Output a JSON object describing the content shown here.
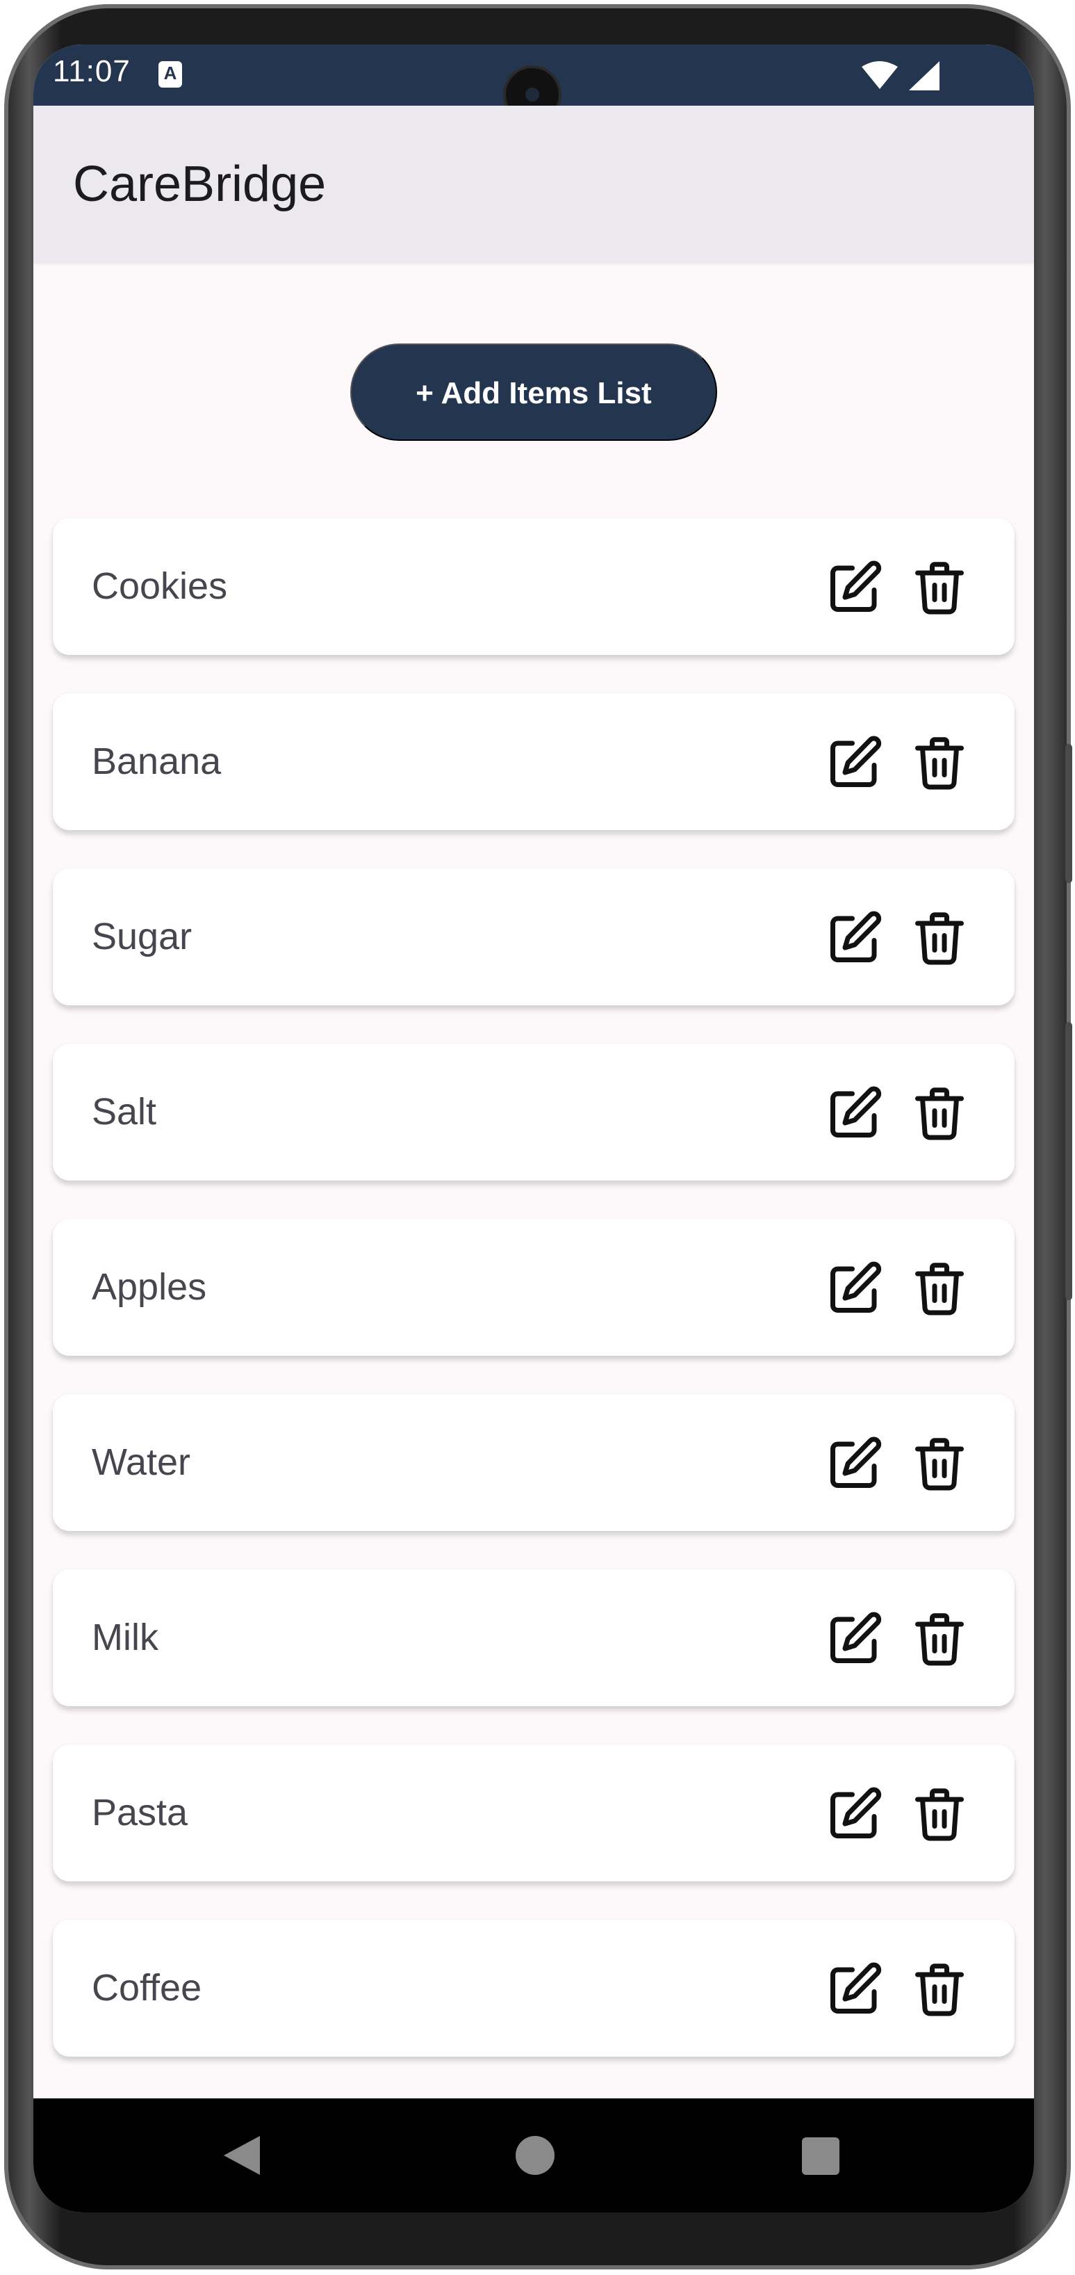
{
  "status_bar": {
    "time": "11:07",
    "notification_badge": "A",
    "icons": [
      "wifi-icon",
      "cellular-signal-icon"
    ]
  },
  "app_bar": {
    "title": "CareBridge"
  },
  "add_button": {
    "label": "+ Add Items List"
  },
  "items": [
    {
      "label": "Cookies"
    },
    {
      "label": "Banana"
    },
    {
      "label": "Sugar"
    },
    {
      "label": "Salt"
    },
    {
      "label": "Apples"
    },
    {
      "label": "Water"
    },
    {
      "label": "Milk"
    },
    {
      "label": "Pasta"
    },
    {
      "label": "Coffee"
    }
  ],
  "item_actions": {
    "edit_icon": "edit-icon",
    "delete_icon": "trash-icon"
  },
  "nav_bar": {
    "icons": [
      "back-icon",
      "home-icon",
      "recents-icon"
    ]
  },
  "colors": {
    "primary": "#243550",
    "app_bar_bg": "#ebe9ee",
    "screen_bg": "#fdf9fb",
    "card_bg": "#ffffff",
    "item_text": "#49454f"
  }
}
